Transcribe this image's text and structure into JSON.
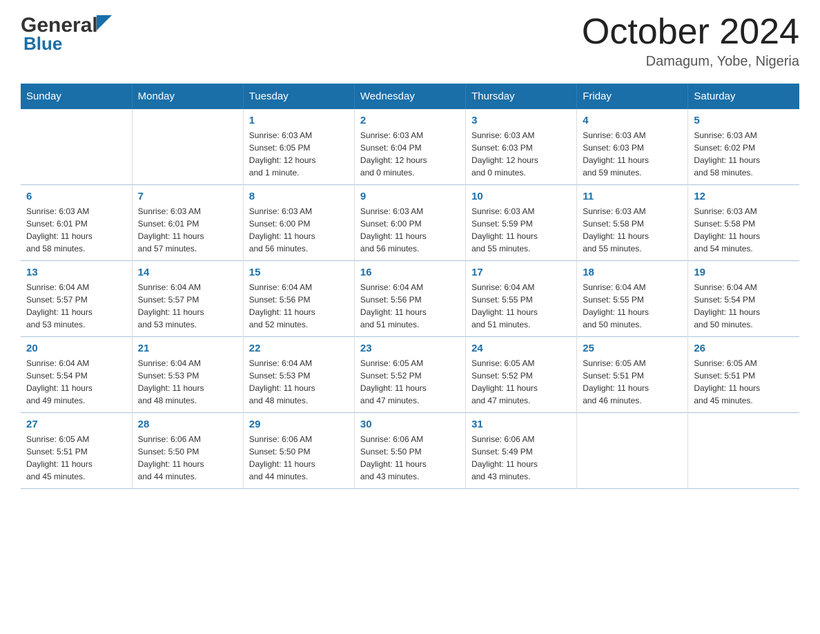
{
  "header": {
    "logo_general": "General",
    "logo_blue": "Blue",
    "month_title": "October 2024",
    "location": "Damagum, Yobe, Nigeria"
  },
  "days_of_week": [
    "Sunday",
    "Monday",
    "Tuesday",
    "Wednesday",
    "Thursday",
    "Friday",
    "Saturday"
  ],
  "weeks": [
    [
      {
        "day": "",
        "info": ""
      },
      {
        "day": "",
        "info": ""
      },
      {
        "day": "1",
        "info": "Sunrise: 6:03 AM\nSunset: 6:05 PM\nDaylight: 12 hours\nand 1 minute."
      },
      {
        "day": "2",
        "info": "Sunrise: 6:03 AM\nSunset: 6:04 PM\nDaylight: 12 hours\nand 0 minutes."
      },
      {
        "day": "3",
        "info": "Sunrise: 6:03 AM\nSunset: 6:03 PM\nDaylight: 12 hours\nand 0 minutes."
      },
      {
        "day": "4",
        "info": "Sunrise: 6:03 AM\nSunset: 6:03 PM\nDaylight: 11 hours\nand 59 minutes."
      },
      {
        "day": "5",
        "info": "Sunrise: 6:03 AM\nSunset: 6:02 PM\nDaylight: 11 hours\nand 58 minutes."
      }
    ],
    [
      {
        "day": "6",
        "info": "Sunrise: 6:03 AM\nSunset: 6:01 PM\nDaylight: 11 hours\nand 58 minutes."
      },
      {
        "day": "7",
        "info": "Sunrise: 6:03 AM\nSunset: 6:01 PM\nDaylight: 11 hours\nand 57 minutes."
      },
      {
        "day": "8",
        "info": "Sunrise: 6:03 AM\nSunset: 6:00 PM\nDaylight: 11 hours\nand 56 minutes."
      },
      {
        "day": "9",
        "info": "Sunrise: 6:03 AM\nSunset: 6:00 PM\nDaylight: 11 hours\nand 56 minutes."
      },
      {
        "day": "10",
        "info": "Sunrise: 6:03 AM\nSunset: 5:59 PM\nDaylight: 11 hours\nand 55 minutes."
      },
      {
        "day": "11",
        "info": "Sunrise: 6:03 AM\nSunset: 5:58 PM\nDaylight: 11 hours\nand 55 minutes."
      },
      {
        "day": "12",
        "info": "Sunrise: 6:03 AM\nSunset: 5:58 PM\nDaylight: 11 hours\nand 54 minutes."
      }
    ],
    [
      {
        "day": "13",
        "info": "Sunrise: 6:04 AM\nSunset: 5:57 PM\nDaylight: 11 hours\nand 53 minutes."
      },
      {
        "day": "14",
        "info": "Sunrise: 6:04 AM\nSunset: 5:57 PM\nDaylight: 11 hours\nand 53 minutes."
      },
      {
        "day": "15",
        "info": "Sunrise: 6:04 AM\nSunset: 5:56 PM\nDaylight: 11 hours\nand 52 minutes."
      },
      {
        "day": "16",
        "info": "Sunrise: 6:04 AM\nSunset: 5:56 PM\nDaylight: 11 hours\nand 51 minutes."
      },
      {
        "day": "17",
        "info": "Sunrise: 6:04 AM\nSunset: 5:55 PM\nDaylight: 11 hours\nand 51 minutes."
      },
      {
        "day": "18",
        "info": "Sunrise: 6:04 AM\nSunset: 5:55 PM\nDaylight: 11 hours\nand 50 minutes."
      },
      {
        "day": "19",
        "info": "Sunrise: 6:04 AM\nSunset: 5:54 PM\nDaylight: 11 hours\nand 50 minutes."
      }
    ],
    [
      {
        "day": "20",
        "info": "Sunrise: 6:04 AM\nSunset: 5:54 PM\nDaylight: 11 hours\nand 49 minutes."
      },
      {
        "day": "21",
        "info": "Sunrise: 6:04 AM\nSunset: 5:53 PM\nDaylight: 11 hours\nand 48 minutes."
      },
      {
        "day": "22",
        "info": "Sunrise: 6:04 AM\nSunset: 5:53 PM\nDaylight: 11 hours\nand 48 minutes."
      },
      {
        "day": "23",
        "info": "Sunrise: 6:05 AM\nSunset: 5:52 PM\nDaylight: 11 hours\nand 47 minutes."
      },
      {
        "day": "24",
        "info": "Sunrise: 6:05 AM\nSunset: 5:52 PM\nDaylight: 11 hours\nand 47 minutes."
      },
      {
        "day": "25",
        "info": "Sunrise: 6:05 AM\nSunset: 5:51 PM\nDaylight: 11 hours\nand 46 minutes."
      },
      {
        "day": "26",
        "info": "Sunrise: 6:05 AM\nSunset: 5:51 PM\nDaylight: 11 hours\nand 45 minutes."
      }
    ],
    [
      {
        "day": "27",
        "info": "Sunrise: 6:05 AM\nSunset: 5:51 PM\nDaylight: 11 hours\nand 45 minutes."
      },
      {
        "day": "28",
        "info": "Sunrise: 6:06 AM\nSunset: 5:50 PM\nDaylight: 11 hours\nand 44 minutes."
      },
      {
        "day": "29",
        "info": "Sunrise: 6:06 AM\nSunset: 5:50 PM\nDaylight: 11 hours\nand 44 minutes."
      },
      {
        "day": "30",
        "info": "Sunrise: 6:06 AM\nSunset: 5:50 PM\nDaylight: 11 hours\nand 43 minutes."
      },
      {
        "day": "31",
        "info": "Sunrise: 6:06 AM\nSunset: 5:49 PM\nDaylight: 11 hours\nand 43 minutes."
      },
      {
        "day": "",
        "info": ""
      },
      {
        "day": "",
        "info": ""
      }
    ]
  ]
}
